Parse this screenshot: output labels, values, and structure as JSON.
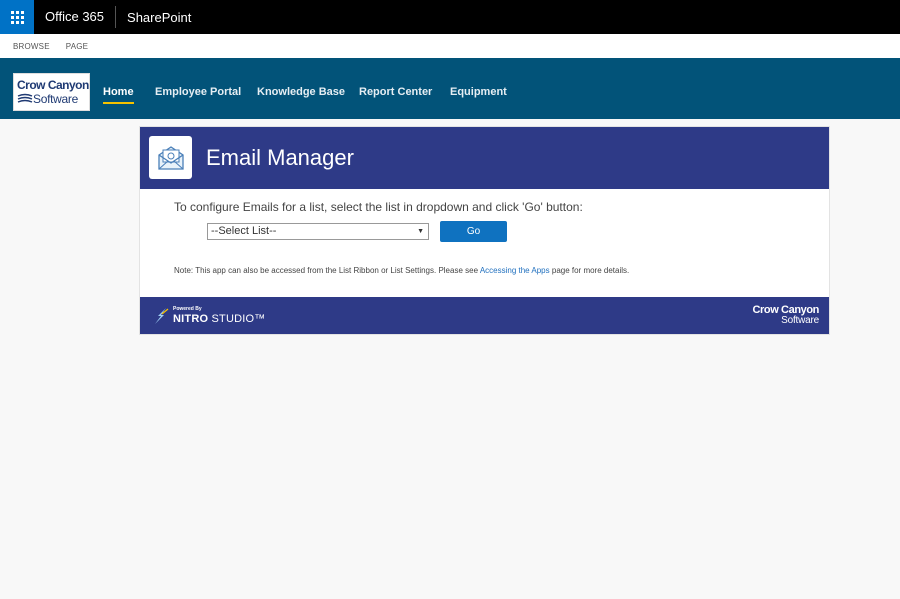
{
  "suite_bar": {
    "app_launcher_icon": "waffle-icon",
    "office_label": "Office 365",
    "sharepoint_label": "SharePoint"
  },
  "ribbon": {
    "tabs": [
      "BROWSE",
      "PAGE"
    ]
  },
  "header": {
    "logo_line1": "Crow Canyon",
    "logo_line2": "Software",
    "nav": [
      {
        "label": "Home",
        "active": true
      },
      {
        "label": "Employee Portal",
        "active": false
      },
      {
        "label": "Knowledge Base",
        "active": false
      },
      {
        "label": "Report Center",
        "active": false
      },
      {
        "label": "Equipment",
        "active": false
      }
    ]
  },
  "app": {
    "icon": "envelope-icon",
    "title": "Email Manager",
    "instruction": "To configure Emails for a list, select the list in dropdown and click 'Go' button:",
    "select": {
      "value": "--Select List--"
    },
    "go_label": "Go",
    "note_prefix": "Note: This app can also be accessed from the List Ribbon or List Settings. Please see ",
    "note_link": "Accessing the Apps",
    "note_suffix": " page for more details."
  },
  "footer": {
    "powered_by": "Powered By",
    "nitro_bold": "NITRO",
    "nitro_rest": " STUDIO™",
    "logo_line1": "Crow Canyon",
    "logo_line2": "Software"
  },
  "colors": {
    "suite_accent": "#0072c6",
    "nav_background": "#025379",
    "nav_active_underline": "#f5c200",
    "app_header": "#2e3a87",
    "button": "#0f72c0",
    "link": "#1f6fbe"
  }
}
